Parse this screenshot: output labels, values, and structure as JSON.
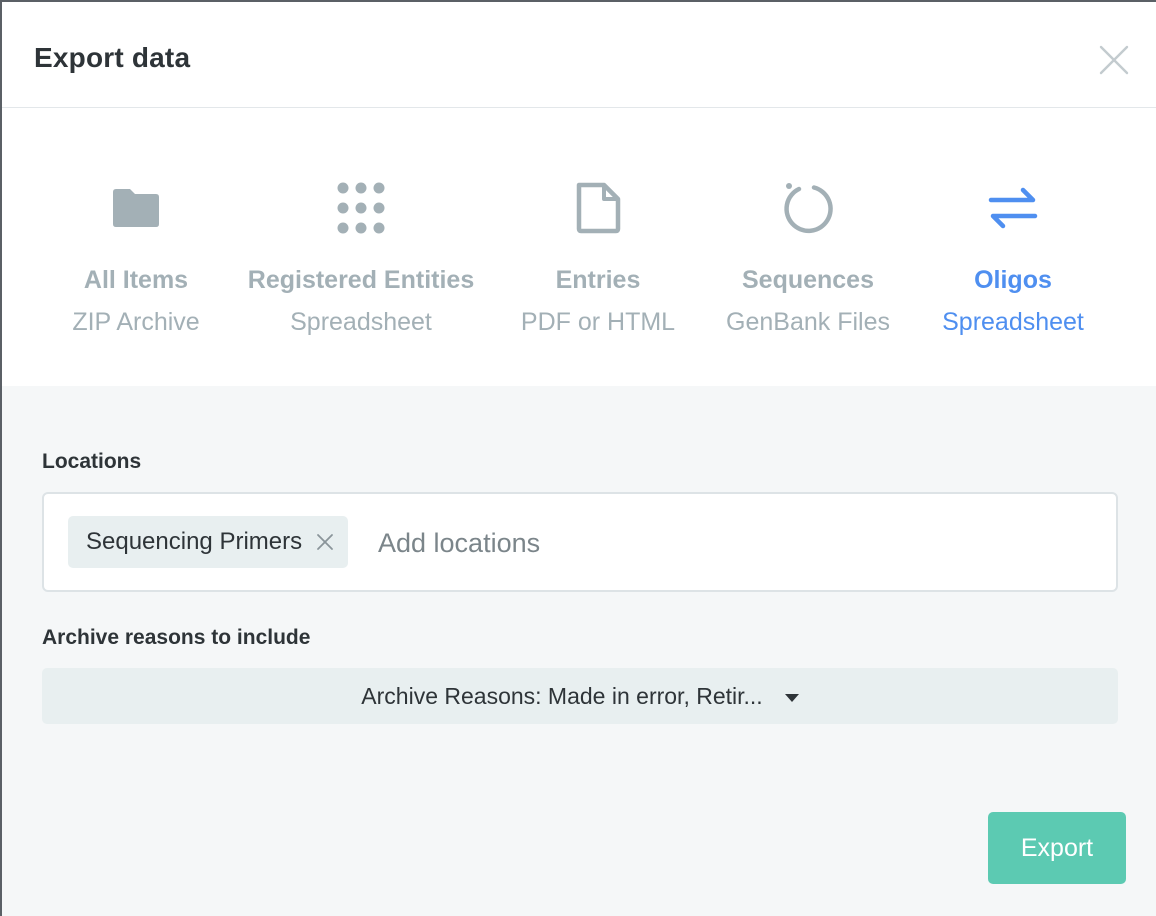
{
  "dialog": {
    "title": "Export data",
    "close_icon": "close-icon"
  },
  "export_types": [
    {
      "label": "All Items",
      "sub": "ZIP Archive",
      "icon": "folder-icon",
      "active": false
    },
    {
      "label": "Registered Entities",
      "sub": "Spreadsheet",
      "icon": "dots-grid-icon",
      "active": false
    },
    {
      "label": "Entries",
      "sub": "PDF or HTML",
      "icon": "document-icon",
      "active": false
    },
    {
      "label": "Sequences",
      "sub": "GenBank Files",
      "icon": "circular-sequence-icon",
      "active": false
    },
    {
      "label": "Oligos",
      "sub": "Spreadsheet",
      "icon": "swap-arrows-icon",
      "active": true
    }
  ],
  "locations": {
    "label": "Locations",
    "chips": [
      "Sequencing Primers"
    ],
    "placeholder": "Add locations"
  },
  "archive": {
    "label": "Archive reasons to include",
    "value": "Archive Reasons: Made in error, Retir..."
  },
  "export_button": "Export",
  "colors": {
    "accent": "#4f8ff0",
    "inactive": "#a3b0b6",
    "export_button": "#5ccab2",
    "panel_bg": "#f5f7f8"
  }
}
